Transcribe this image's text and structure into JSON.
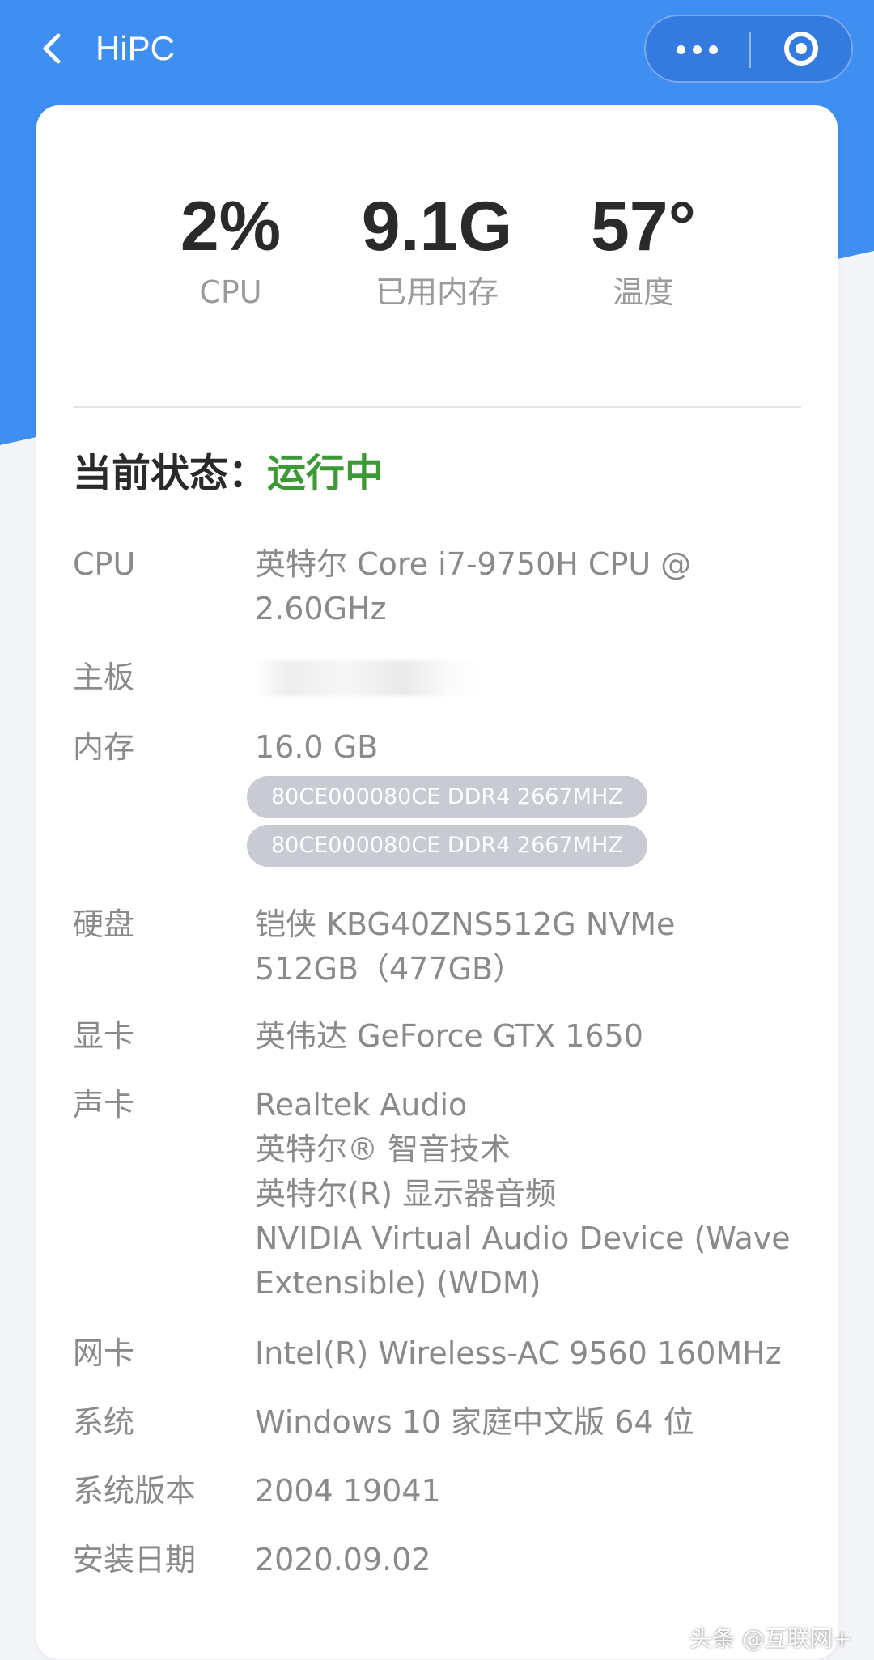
{
  "header": {
    "title": "HiPC"
  },
  "stats": {
    "cpu": {
      "value": "2%",
      "label": "CPU"
    },
    "memory": {
      "value": "9.1G",
      "label": "已用内存"
    },
    "temperature": {
      "value": "57°",
      "label": "温度"
    }
  },
  "status": {
    "label": "当前状态：",
    "value": "运行中",
    "color": "#3c9a35"
  },
  "specs": {
    "cpu": {
      "label": "CPU",
      "lines": [
        "英特尔 Core i7-9750H CPU @",
        "2.60GHz"
      ]
    },
    "motherboard": {
      "label": "主板"
    },
    "memory": {
      "label": "内存",
      "value": "16.0 GB",
      "modules": [
        "80CE000080CE DDR4 2667MHZ",
        "80CE000080CE DDR4 2667MHZ"
      ]
    },
    "disk": {
      "label": "硬盘",
      "lines": [
        "铠侠 KBG40ZNS512G NVMe",
        "512GB（477GB）"
      ]
    },
    "gpu": {
      "label": "显卡",
      "value": "英伟达 GeForce GTX 1650"
    },
    "audio": {
      "label": "声卡",
      "lines": [
        "Realtek Audio",
        "英特尔® 智音技术",
        "英特尔(R) 显示器音频",
        "NVIDIA Virtual Audio Device (Wave",
        "Extensible) (WDM)"
      ]
    },
    "network": {
      "label": "网卡",
      "value": "Intel(R) Wireless-AC 9560 160MHz"
    },
    "os": {
      "label": "系统",
      "value": "Windows 10 家庭中文版 64 位"
    },
    "os_version": {
      "label": "系统版本",
      "value": "2004 19041"
    },
    "install_date": {
      "label": "安装日期",
      "value": "2020.09.02"
    }
  },
  "watermark": "头条 @互联网+",
  "colors": {
    "accent": "#3f8ef2",
    "chip_bg": "#c8cbd4",
    "text_gray": "#8a8a8a"
  }
}
